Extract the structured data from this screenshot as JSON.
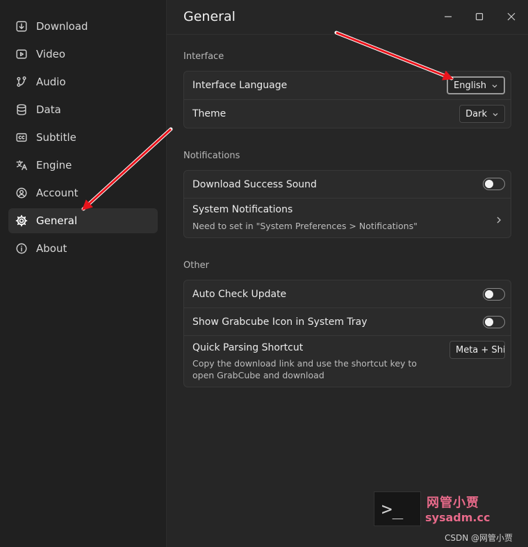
{
  "sidebar": {
    "items": [
      {
        "label": "Download",
        "icon": "download-icon",
        "active": false
      },
      {
        "label": "Video",
        "icon": "video-icon",
        "active": false
      },
      {
        "label": "Audio",
        "icon": "audio-icon",
        "active": false
      },
      {
        "label": "Data",
        "icon": "database-icon",
        "active": false
      },
      {
        "label": "Subtitle",
        "icon": "subtitle-icon",
        "active": false
      },
      {
        "label": "Engine",
        "icon": "translate-icon",
        "active": false
      },
      {
        "label": "Account",
        "icon": "account-icon",
        "active": false
      },
      {
        "label": "General",
        "icon": "gear-icon",
        "active": true
      },
      {
        "label": "About",
        "icon": "info-icon",
        "active": false
      }
    ]
  },
  "header": {
    "title": "General"
  },
  "sections": {
    "interface": {
      "label": "Interface",
      "language_label": "Interface Language",
      "language_value": "English",
      "theme_label": "Theme",
      "theme_value": "Dark"
    },
    "notifications": {
      "label": "Notifications",
      "sound_label": "Download Success Sound",
      "sound_on": false,
      "system_label": "System Notifications",
      "system_desc": "Need to set in \"System Preferences > Notifications\""
    },
    "other": {
      "label": "Other",
      "auto_update_label": "Auto Check Update",
      "auto_update_on": false,
      "tray_label": "Show Grabcube Icon in System Tray",
      "tray_on": false,
      "shortcut_label": "Quick Parsing Shortcut",
      "shortcut_desc": "Copy the download link and use the shortcut key to open GrabCube and download",
      "shortcut_value": "Meta + Shi"
    }
  },
  "watermark": {
    "prompt": ">_",
    "cn_text": "网管小贾",
    "url": "sysadm.cc",
    "csdn": "CSDN @网管小贾"
  },
  "colors": {
    "annotation_arrow": "#e8141c",
    "sidebar_bg": "#202020",
    "main_bg": "#262626",
    "card_bg": "#2b2b2b"
  }
}
